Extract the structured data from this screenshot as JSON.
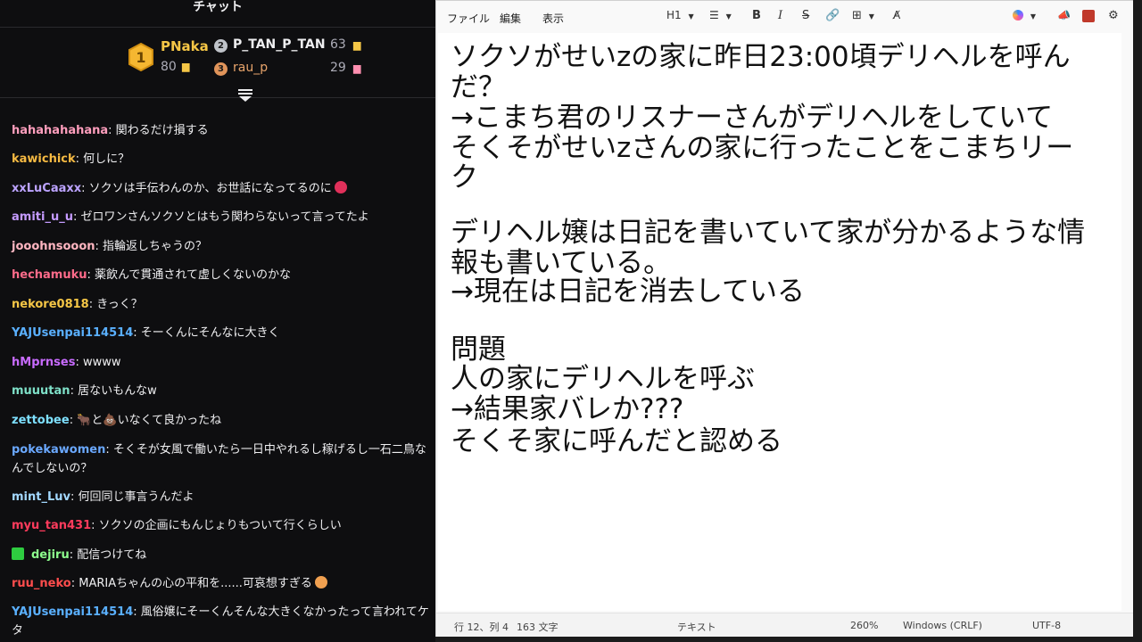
{
  "chat": {
    "title": "チャット",
    "leaderboard": {
      "first": {
        "name": "PNaka",
        "score": "80",
        "rank": "1"
      },
      "second": {
        "name": "P_TAN_P_TAN",
        "score": "63",
        "rank": "2"
      },
      "third": {
        "name": "rau_p",
        "score": "29",
        "rank": "3"
      }
    },
    "messages": [
      {
        "user": "hahahahahana",
        "color": "#ff9ebd",
        "text": ": 関わるだけ損する"
      },
      {
        "user": "kawichick",
        "color": "#f5b942",
        "text": ": 何しに？"
      },
      {
        "user": "xxLuCaaxx",
        "color": "#bca3ff",
        "text": ": ソクソは手伝わんのか、お世話になってるのに"
      },
      {
        "user": "amiti_u_u",
        "color": "#c59bff",
        "text": ": ゼロワンさんソクソとはもう関わらないって言ってたよ"
      },
      {
        "user": "jooohnsooon",
        "color": "#ffb6c1",
        "text": ": 指輪返しちゃうの？"
      },
      {
        "user": "hechamuku",
        "color": "#ff6b8a",
        "text": ": 薬飲んで貫通されて虚しくないのかな"
      },
      {
        "user": "nekore0818",
        "color": "#f5c646",
        "text": ": きっく？"
      },
      {
        "user": "YAJUsenpai114514",
        "color": "#5ab0ff",
        "text": ": そーくんにそんなに大きく"
      },
      {
        "user": "hMprnses",
        "color": "#c86bff",
        "text": ": wwww"
      },
      {
        "user": "muuutan",
        "color": "#7ee0c8",
        "text": ": 居ないもんなw"
      },
      {
        "user": "zettobee",
        "color": "#7ee0ff",
        "text": ": 🐂と💩いなくて良かったね"
      },
      {
        "user": "pokekawomen",
        "color": "#6aa8ff",
        "text": ": そくそが女風で働いたら一日中やれるし稼げるし一石二鳥なんでしないの？"
      },
      {
        "user": "mint_Luv",
        "color": "#a3d8ff",
        "text": ": 何回同じ事言うんだよ"
      },
      {
        "user": "myu_tan431",
        "color": "#ff3b5c",
        "text": ": ソクソの企画にもんじょりもついて行くらしい"
      },
      {
        "user": "dejiru",
        "color": "#8dff8d",
        "text": ": 配信つけてね"
      },
      {
        "user": "ruu_neko",
        "color": "#ff4d4d",
        "text": ": MARIAちゃんの心の平和を......可哀想すぎる"
      },
      {
        "user": "YAJUsenpai114514",
        "color": "#5ab0ff",
        "text": ": 風俗嬢にそーくんそんな大きくなかったって言われてケタ"
      }
    ]
  },
  "notepad": {
    "menu": {
      "file": "ファイル",
      "edit": "編集",
      "view": "表示"
    },
    "toolbar": {
      "heading": "H1"
    },
    "lines": [
      "ソクソがせいzの家に昨日23:00頃デリヘルを呼ん",
      "だ？",
      "→こまち君のリスナーさんがデリヘルをしていて",
      "そくそがせいzさんの家に行ったことをこまちリー",
      "ク",
      "",
      "デリヘル嬢は日記を書いていて家が分かるような情",
      "報も書いている。",
      "→現在は日記を消去している",
      "",
      "問題",
      "人の家にデリヘルを呼ぶ",
      "→結果家バレか???",
      "",
      "そくそ家に呼んだと認める"
    ],
    "status": {
      "position": "行 12、列 4",
      "chars": "163 文字",
      "format": "テキスト",
      "zoom": "260%",
      "line_ending": "Windows (CRLF)",
      "encoding": "UTF-8"
    }
  }
}
